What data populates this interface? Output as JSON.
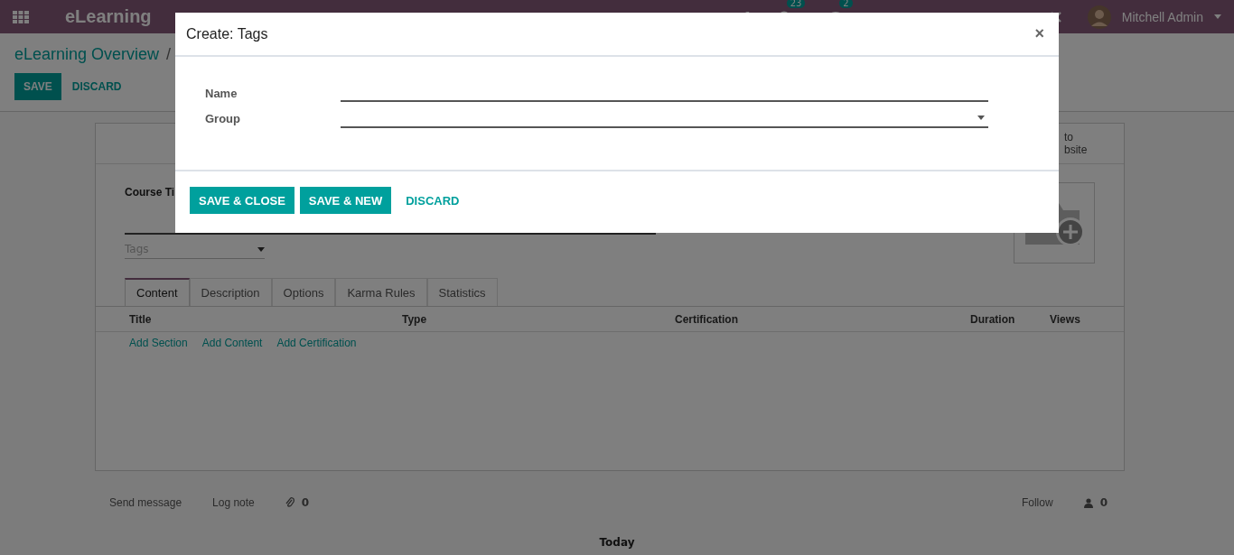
{
  "navbar": {
    "app_name": "eLearning",
    "activity_count": "23",
    "message_count": "2",
    "user": "Mitchell Admin"
  },
  "breadcrumb": [
    "eLearning Overview",
    "/"
  ],
  "control_buttons": [
    {
      "label": "SAVE",
      "kind": "primary"
    },
    {
      "label": "DISCARD",
      "kind": "link"
    }
  ],
  "form": {
    "website_button": [
      "to",
      "bsite"
    ],
    "title_label": "Course Ti",
    "tags_placeholder": "Tags",
    "tabs": [
      {
        "label": "Content",
        "selected": true
      },
      {
        "label": "Description",
        "selected": false
      },
      {
        "label": "Options",
        "selected": false
      },
      {
        "label": "Karma Rules",
        "selected": false
      },
      {
        "label": "Statistics",
        "selected": false
      }
    ],
    "columns": [
      "Title",
      "Type",
      "Certification",
      "Duration",
      "Views"
    ],
    "add_links": [
      "Add Section",
      "Add Content",
      "Add Certification"
    ]
  },
  "chatter": {
    "send": "Send message",
    "log": "Log note",
    "attachments": "0",
    "follow": "Follow",
    "followers": "0",
    "date_separator": "Today"
  },
  "dialog": {
    "title": "Create: Tags",
    "close": "×",
    "fields": [
      {
        "label": "Name",
        "kind": "text"
      },
      {
        "label": "Group",
        "kind": "select"
      }
    ],
    "buttons": [
      {
        "label": "SAVE & CLOSE",
        "kind": "primary"
      },
      {
        "label": "SAVE & NEW",
        "kind": "primary"
      },
      {
        "label": "DISCARD",
        "kind": "link"
      }
    ]
  }
}
